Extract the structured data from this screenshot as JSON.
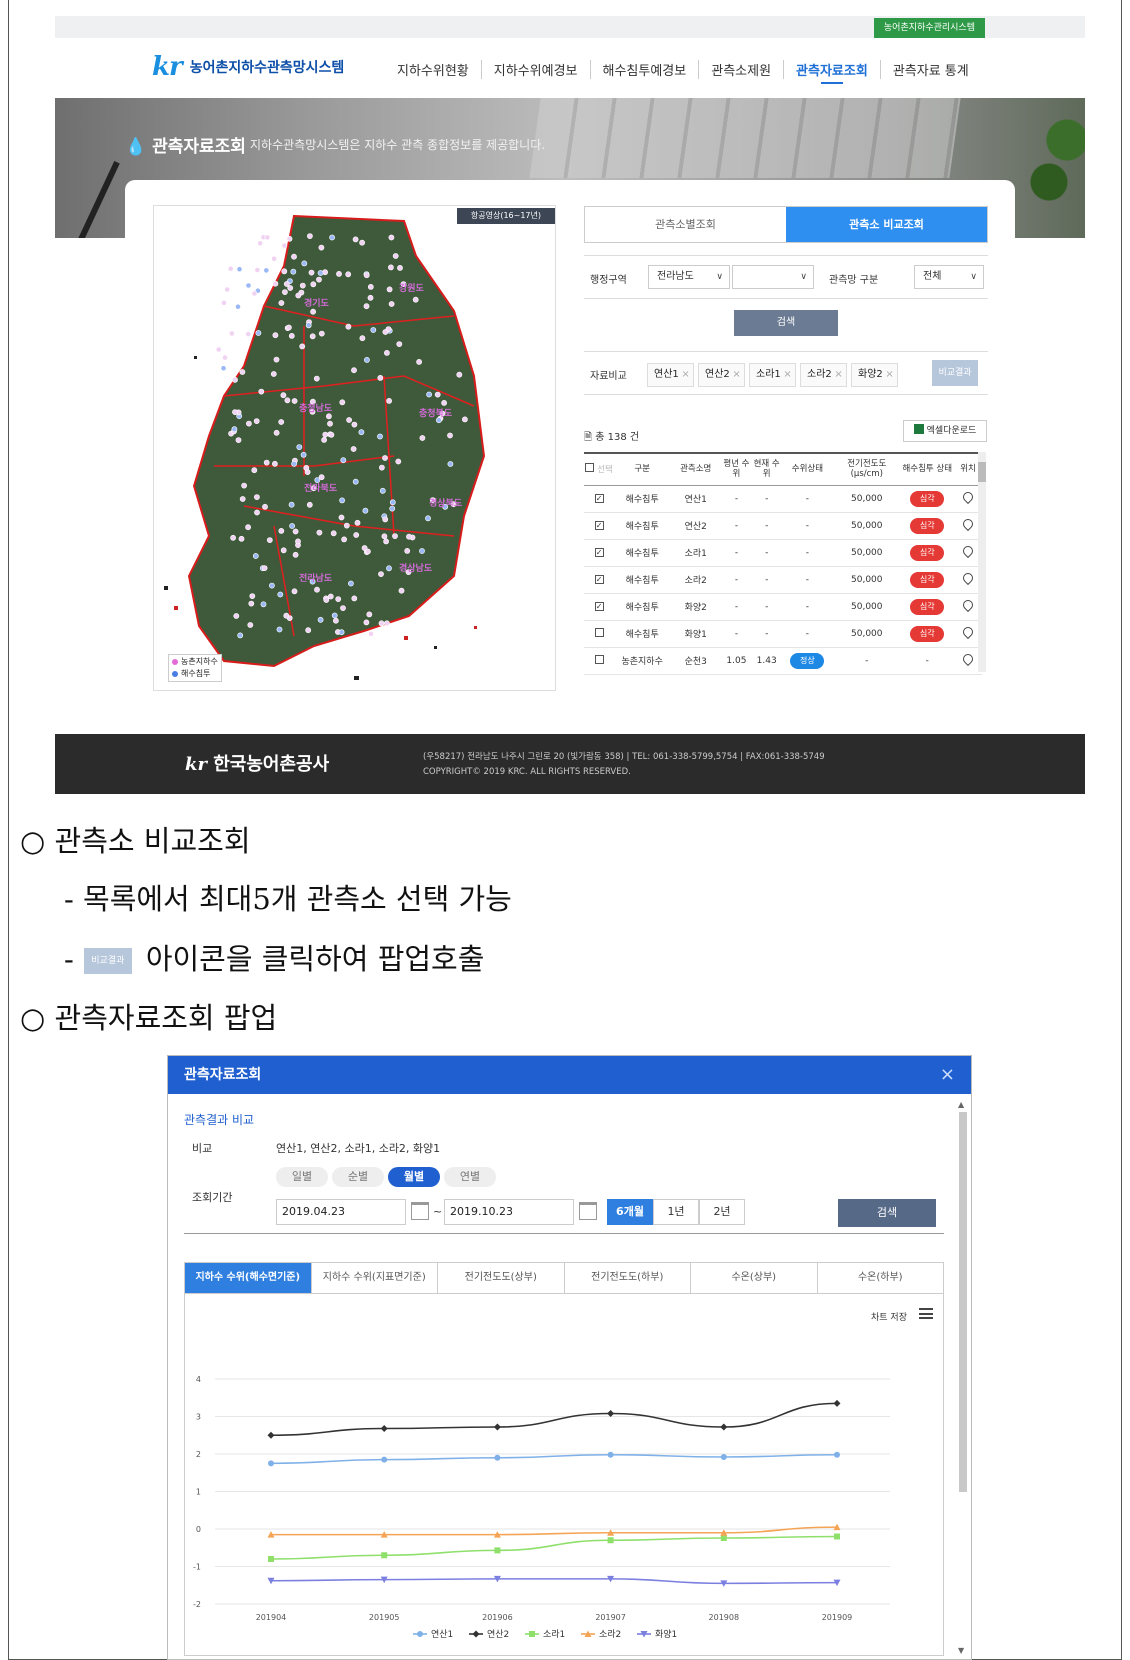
{
  "site": {
    "topbar_link": "농어촌지하수관리시스템",
    "logo_mark": "kr",
    "logo_text": "농어촌지하수관측망시스템",
    "nav": [
      "지하수위현황",
      "지하수위예경보",
      "해수침투예경보",
      "관측소제원",
      "관측자료조회",
      "관측자료 통계"
    ],
    "active_nav": 4,
    "hero_title": "관측자료조회",
    "hero_subtitle": "지하수관측망시스템은 지하수 관측 종합정보를 제공합니다."
  },
  "map": {
    "badge": "항공영상(16~17년)",
    "regions": [
      "경기도",
      "강원도",
      "충청남도",
      "충청북도",
      "전라북도",
      "경상북도",
      "전라남도",
      "경상남도"
    ],
    "legend": [
      {
        "label": "농촌지하수",
        "color": "#e46ad6"
      },
      {
        "label": "해수침투",
        "color": "#4a7de6"
      }
    ]
  },
  "panel": {
    "tabs": [
      "관측소별조회",
      "관측소 비교조회"
    ],
    "active_tab": 1,
    "admin_label": "행정구역",
    "admin_value": "전라남도",
    "admin_value2": "",
    "network_label": "관측망 구분",
    "network_value": "전체",
    "search_label": "검색",
    "compare_label": "자료비교",
    "compare_chips": [
      "연산1",
      "연산2",
      "소라1",
      "소라2",
      "화양2"
    ],
    "compare_button": "비교결과",
    "total": "총 138 건",
    "excel_button": "엑셀다운로드",
    "columns": [
      "선택",
      "구분",
      "관측소명",
      "평년 수위",
      "현재 수위",
      "수위상태",
      "전기전도도 (μs/cm)",
      "해수침투 상태",
      "위치"
    ],
    "rows": [
      {
        "checked": true,
        "type": "해수침투",
        "name": "연산1",
        "avg": "-",
        "cur": "-",
        "state": "-",
        "ec": "50,000",
        "sea": "심각",
        "sea_kind": "red"
      },
      {
        "checked": true,
        "type": "해수침투",
        "name": "연산2",
        "avg": "-",
        "cur": "-",
        "state": "-",
        "ec": "50,000",
        "sea": "심각",
        "sea_kind": "red"
      },
      {
        "checked": true,
        "type": "해수침투",
        "name": "소라1",
        "avg": "-",
        "cur": "-",
        "state": "-",
        "ec": "50,000",
        "sea": "심각",
        "sea_kind": "red"
      },
      {
        "checked": true,
        "type": "해수침투",
        "name": "소라2",
        "avg": "-",
        "cur": "-",
        "state": "-",
        "ec": "50,000",
        "sea": "심각",
        "sea_kind": "red"
      },
      {
        "checked": true,
        "type": "해수침투",
        "name": "화양2",
        "avg": "-",
        "cur": "-",
        "state": "-",
        "ec": "50,000",
        "sea": "심각",
        "sea_kind": "red"
      },
      {
        "checked": false,
        "type": "해수침투",
        "name": "화양1",
        "avg": "-",
        "cur": "-",
        "state": "-",
        "ec": "50,000",
        "sea": "심각",
        "sea_kind": "red"
      },
      {
        "checked": false,
        "type": "농촌지하수",
        "name": "순천3",
        "avg": "1.05",
        "cur": "1.43",
        "state": "정상",
        "ec": "-",
        "sea": "-",
        "sea_kind": "none"
      }
    ]
  },
  "footer": {
    "logo_mark": "kr",
    "logo_text": "한국농어촌공사",
    "address": "(우58217) 전라남도 나주시 그린로 20 (빛가람동 358) | TEL: 061-338-5799,5754 | FAX:061-338-5749",
    "copyright": "COPYRIGHT© 2019 KRC. ALL RIGHTS RESERVED."
  },
  "doc": {
    "bullet1": "○ 관측소 비교조회",
    "line1": "- 목록에서 최대5개 관측소 선택 가능",
    "line2_prefix": "-",
    "line2_btn": "비교결과",
    "line2_suffix": "아이콘을 클릭하여 팝업호출",
    "bullet2": "○ 관측자료조회 팝업"
  },
  "popup": {
    "title": "관측자료조회",
    "close_icon": "×",
    "section_title": "관측결과 비교",
    "compare_label": "비교",
    "compare_value": "연산1, 연산2, 소라1, 소라2, 화양1",
    "period_label": "조회기간",
    "period_types": [
      "일별",
      "순별",
      "월별",
      "연별"
    ],
    "active_period_type": 2,
    "date_from": "2019.04.23",
    "date_sep": "~",
    "date_to": "2019.10.23",
    "ranges": [
      "6개월",
      "1년",
      "2년"
    ],
    "active_range": 0,
    "search_label": "검색",
    "chart_tabs": [
      "지하수 수위(해수면기준)",
      "지하수 수위(지표면기준)",
      "전기전도도(상부)",
      "전기전도도(하부)",
      "수온(상부)",
      "수온(하부)"
    ],
    "active_chart_tab": 0,
    "chart_save": "차트 저장"
  },
  "chart_data": {
    "type": "line",
    "title": "",
    "xlabel": "",
    "ylabel": "",
    "categories": [
      "201904",
      "201905",
      "201906",
      "201907",
      "201908",
      "201909"
    ],
    "ylim": [
      -2,
      4
    ],
    "yticks": [
      4,
      3,
      2,
      1,
      0,
      -1,
      -2
    ],
    "grid": true,
    "legend_position": "bottom",
    "series": [
      {
        "name": "연산1",
        "color": "#7fb1e8",
        "marker": "circle",
        "values": [
          1.75,
          1.85,
          1.9,
          1.98,
          1.92,
          1.98
        ]
      },
      {
        "name": "연산2",
        "color": "#333333",
        "marker": "diamond",
        "values": [
          2.5,
          2.68,
          2.72,
          3.08,
          2.72,
          3.35
        ]
      },
      {
        "name": "소라1",
        "color": "#8ee06b",
        "marker": "square",
        "values": [
          -0.8,
          -0.7,
          -0.57,
          -0.3,
          -0.24,
          -0.2
        ]
      },
      {
        "name": "소라2",
        "color": "#f5a455",
        "marker": "triangle",
        "values": [
          -0.15,
          -0.15,
          -0.15,
          -0.1,
          -0.1,
          0.05
        ]
      },
      {
        "name": "화양1",
        "color": "#7a7fe0",
        "marker": "triangle-down",
        "values": [
          -1.38,
          -1.35,
          -1.33,
          -1.33,
          -1.45,
          -1.43
        ]
      }
    ]
  }
}
